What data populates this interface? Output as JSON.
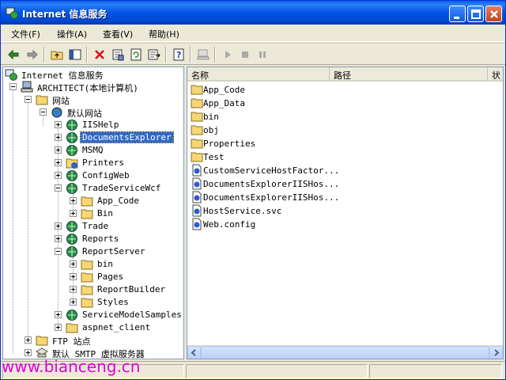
{
  "window": {
    "title": "Internet 信息服务"
  },
  "menu": [
    {
      "label": "文件(F)"
    },
    {
      "label": "操作(A)"
    },
    {
      "label": "查看(V)"
    },
    {
      "label": "帮助(H)"
    }
  ],
  "tree": {
    "items": [
      {
        "label": "Internet 信息服务"
      },
      {
        "label": "ARCHITECT(本地计算机)"
      },
      {
        "label": "网站"
      },
      {
        "label": "默认网站"
      },
      {
        "label": "IISHelp"
      },
      {
        "label": "DocumentsExplorer"
      },
      {
        "label": "MSMQ"
      },
      {
        "label": "Printers"
      },
      {
        "label": "ConfigWeb"
      },
      {
        "label": "TradeServiceWcf"
      },
      {
        "label": "App_Code"
      },
      {
        "label": "Bin"
      },
      {
        "label": "Trade"
      },
      {
        "label": "Reports"
      },
      {
        "label": "ReportServer"
      },
      {
        "label": "bin"
      },
      {
        "label": "Pages"
      },
      {
        "label": "ReportBuilder"
      },
      {
        "label": "Styles"
      },
      {
        "label": "ServiceModelSamples"
      },
      {
        "label": "aspnet_client"
      },
      {
        "label": "FTP 站点"
      },
      {
        "label": "默认 SMTP 虚拟服务器"
      }
    ]
  },
  "list": {
    "columns": [
      {
        "label": "名称"
      },
      {
        "label": "路径"
      },
      {
        "label": "状"
      }
    ],
    "items": [
      {
        "label": "App_Code",
        "icon": "folder"
      },
      {
        "label": "App_Data",
        "icon": "folder"
      },
      {
        "label": "bin",
        "icon": "folder"
      },
      {
        "label": "obj",
        "icon": "folder"
      },
      {
        "label": "Properties",
        "icon": "folder"
      },
      {
        "label": "Test",
        "icon": "folder"
      },
      {
        "label": "CustomServiceHostFactor...",
        "icon": "file"
      },
      {
        "label": "DocumentsExplorerIISHos...",
        "icon": "file"
      },
      {
        "label": "DocumentsExplorerIISHos...",
        "icon": "file"
      },
      {
        "label": "HostService.svc",
        "icon": "file"
      },
      {
        "label": "Web.config",
        "icon": "file"
      }
    ]
  },
  "watermark": {
    "text": "www.bianceng.cn"
  },
  "colors": {
    "titlebar": "#0054e3",
    "selection": "#316ac5",
    "watermark": "#e000e0"
  }
}
